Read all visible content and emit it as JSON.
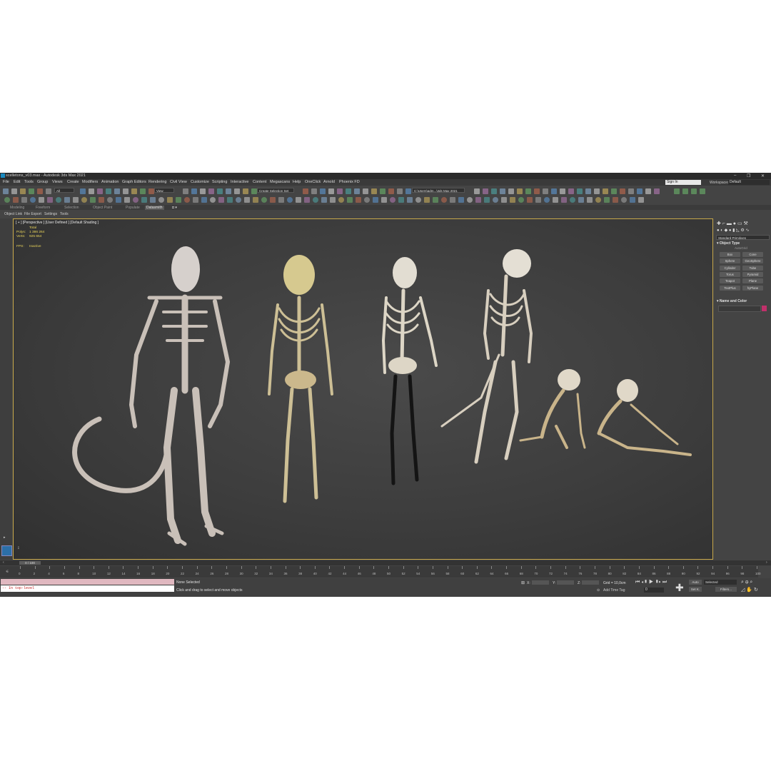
{
  "window": {
    "title": "scelletons_v03.max - Autodesk 3ds Max 2021"
  },
  "menu": [
    "File",
    "Edit",
    "Tools",
    "Group",
    "Views",
    "Create",
    "Modifiers",
    "Animation",
    "Graph Editors",
    "Rendering",
    "Civil View",
    "Customize",
    "Scripting",
    "Interactive",
    "Content",
    "Megascans",
    "Help",
    "OneClick",
    "Arnold",
    "Phoenix FD"
  ],
  "account": {
    "sign_in": "Sign In",
    "workspaces_label": "Workspaces:",
    "workspace": "Default"
  },
  "toolbar": {
    "filter": "All",
    "view": "View",
    "selection_set": "Create Selection Set",
    "path": "C:\\Users\\adm...\\3ds Max 2021"
  },
  "ribbon": {
    "tabs": [
      "Modeling",
      "Freeform",
      "Selection",
      "Object Paint",
      "Populate",
      "Datasmith"
    ],
    "active": "Datasmith"
  },
  "subbar": [
    "Object Link",
    "File Export",
    "Settings",
    "Tools"
  ],
  "viewport": {
    "label": "[ + ] [Perspective ] [User Defined ] [Default Shading ]",
    "stats": {
      "total": "Total",
      "polys_label": "Polys:",
      "polys": "1 386 264",
      "verts_label": "Verts:",
      "verts": "925 654",
      "fps_label": "FPS:",
      "fps": "Inactive"
    }
  },
  "command_panel": {
    "dropdown": "Standard Primitives",
    "object_type_title": "Object Type",
    "autogrid": "AutoGrid",
    "buttons": [
      "Box",
      "Cone",
      "Sphere",
      "GeoSphere",
      "Cylinder",
      "Tube",
      "Torus",
      "Pyramid",
      "Teapot",
      "Plane",
      "TextPlus",
      "hyPlane"
    ],
    "name_color_title": "Name and Color",
    "object_color": "#c0306a"
  },
  "timeline": {
    "slider": "0 / 100",
    "ticks": [
      "0",
      "2",
      "4",
      "6",
      "8",
      "10",
      "12",
      "14",
      "16",
      "18",
      "20",
      "22",
      "24",
      "26",
      "28",
      "30",
      "32",
      "34",
      "36",
      "38",
      "40",
      "42",
      "44",
      "46",
      "48",
      "50",
      "52",
      "54",
      "56",
      "58",
      "60",
      "62",
      "64",
      "66",
      "68",
      "70",
      "72",
      "74",
      "76",
      "78",
      "80",
      "82",
      "84",
      "86",
      "88",
      "90",
      "92",
      "94",
      "96",
      "98",
      "100"
    ]
  },
  "status": {
    "selection": "None Selected",
    "prompt": "Click and drag to select and move objects",
    "maxscript": "-- In top-level",
    "x_label": "X:",
    "y_label": "Y:",
    "z_label": "Z:",
    "grid": "Grid = 10,0cm",
    "add_time_tag": "Add Time Tag",
    "auto": "Auto",
    "set_k": "Set K.",
    "selected": "Selected",
    "filters": "Filters...",
    "frame": "0"
  }
}
